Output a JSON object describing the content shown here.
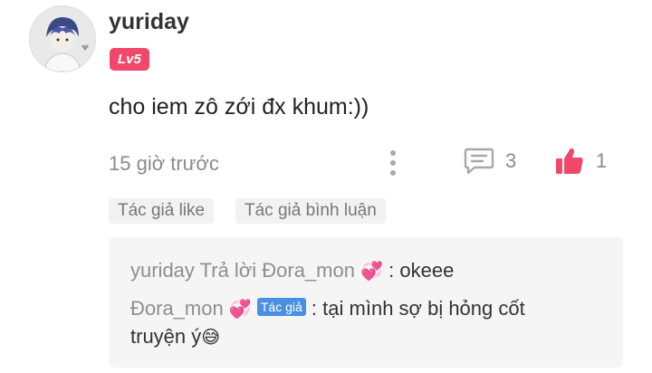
{
  "comment": {
    "username": "yuriday",
    "level": "Lv5",
    "text": "cho iem zô zới đx khum:))",
    "timestamp": "15 giờ trước",
    "reply_count": "3",
    "like_count": "1"
  },
  "tags": [
    "Tác giả like",
    "Tác giả bình luận"
  ],
  "replies": [
    {
      "from": "yuriday Trả lời Đora_mon",
      "emoji": "💞",
      "separator": ":",
      "text": "okeee"
    },
    {
      "from": "Đora_mon",
      "emoji": "💞",
      "badge": "Tác giả",
      "separator": ":",
      "text_line1": "tại mình sợ bị hỏng cốt",
      "text_line2": "truyện ý",
      "end_emoji": "😅"
    }
  ],
  "colors": {
    "accent_like": "#f0476b",
    "badge_level": "#f0476b",
    "badge_author": "#4a90e2",
    "muted_text": "#8a8a8a"
  },
  "icons": {
    "more": "more-vertical-icon",
    "reply": "comment-icon",
    "like": "thumbs-up-icon"
  }
}
